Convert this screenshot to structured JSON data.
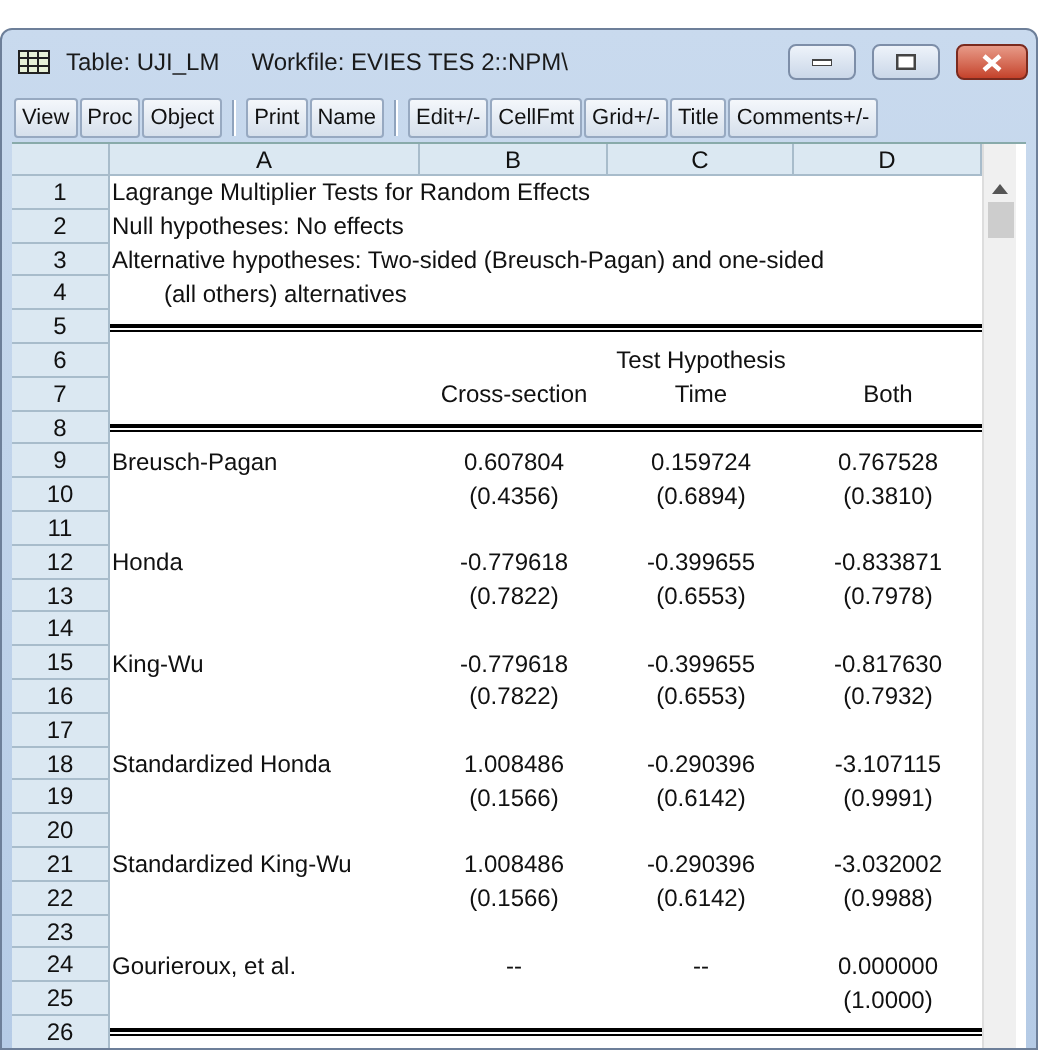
{
  "window": {
    "title": "Table: UJI_LM",
    "workfile": "Workfile: EVIES TES 2::NPM\\"
  },
  "toolbar": [
    {
      "label": "View",
      "group_start": false
    },
    {
      "label": "Proc",
      "group_start": false
    },
    {
      "label": "Object",
      "group_start": false
    },
    {
      "label": "Print",
      "group_start": true
    },
    {
      "label": "Name",
      "group_start": false
    },
    {
      "label": "Edit+/-",
      "group_start": true
    },
    {
      "label": "CellFmt",
      "group_start": false
    },
    {
      "label": "Grid+/-",
      "group_start": false
    },
    {
      "label": "Title",
      "group_start": false
    },
    {
      "label": "Comments+/-",
      "group_start": false
    }
  ],
  "columns": [
    "A",
    "B",
    "C",
    "D"
  ],
  "rows": [
    {
      "number": "1",
      "a": "Lagrange Multiplier Tests for Random Effects"
    },
    {
      "number": "2",
      "a": "Null hypotheses: No effects"
    },
    {
      "number": "3",
      "a": "Alternative hypotheses: Two-sided (Breusch-Pagan) and one-sided"
    },
    {
      "number": "4",
      "a": "(all others) alternatives",
      "indent": true
    },
    {
      "number": "5",
      "double_rule": true
    },
    {
      "number": "6",
      "c": "Test Hypothesis"
    },
    {
      "number": "7",
      "b": "Cross-section",
      "c": "Time",
      "d": "Both"
    },
    {
      "number": "8",
      "double_rule": true
    },
    {
      "number": "9",
      "a": "Breusch-Pagan",
      "b": "0.607804",
      "c": "0.159724",
      "d": "0.767528"
    },
    {
      "number": "10",
      "b": "(0.4356)",
      "c": "(0.6894)",
      "d": "(0.3810)"
    },
    {
      "number": "11"
    },
    {
      "number": "12",
      "a": "Honda",
      "b": "-0.779618",
      "c": "-0.399655",
      "d": "-0.833871"
    },
    {
      "number": "13",
      "b": "(0.7822)",
      "c": "(0.6553)",
      "d": "(0.7978)"
    },
    {
      "number": "14"
    },
    {
      "number": "15",
      "a": "King-Wu",
      "b": "-0.779618",
      "c": "-0.399655",
      "d": "-0.817630"
    },
    {
      "number": "16",
      "b": "(0.7822)",
      "c": "(0.6553)",
      "d": "(0.7932)"
    },
    {
      "number": "17"
    },
    {
      "number": "18",
      "a": "Standardized Honda",
      "b": "1.008486",
      "c": "-0.290396",
      "d": "-3.107115"
    },
    {
      "number": "19",
      "b": "(0.1566)",
      "c": "(0.6142)",
      "d": "(0.9991)"
    },
    {
      "number": "20"
    },
    {
      "number": "21",
      "a": "Standardized King-Wu",
      "b": "1.008486",
      "c": "-0.290396",
      "d": "-3.032002"
    },
    {
      "number": "22",
      "b": "(0.1566)",
      "c": "(0.6142)",
      "d": "(0.9988)"
    },
    {
      "number": "23"
    },
    {
      "number": "24",
      "a": "Gourieroux, et al.",
      "b": "--",
      "c": "--",
      "d": "0.000000"
    },
    {
      "number": "25",
      "d": "(1.0000)"
    },
    {
      "number": "26",
      "double_rule": true
    }
  ]
}
